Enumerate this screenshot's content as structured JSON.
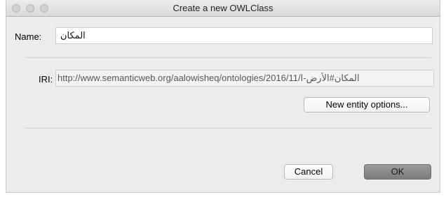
{
  "window": {
    "title": "Create a new OWLClass"
  },
  "form": {
    "name_label": "Name:",
    "name_value": "المكان",
    "iri_label": "IRI:",
    "iri_value": "http://www.semanticweb.org/aalowisheq/ontologies/2016/11/المكان#الأرض-ا",
    "entity_options_label": "New entity options..."
  },
  "footer": {
    "cancel_label": "Cancel",
    "ok_label": "OK"
  },
  "colors": {
    "window_bg": "#ececec",
    "ok_button": "#8a8a8a"
  }
}
